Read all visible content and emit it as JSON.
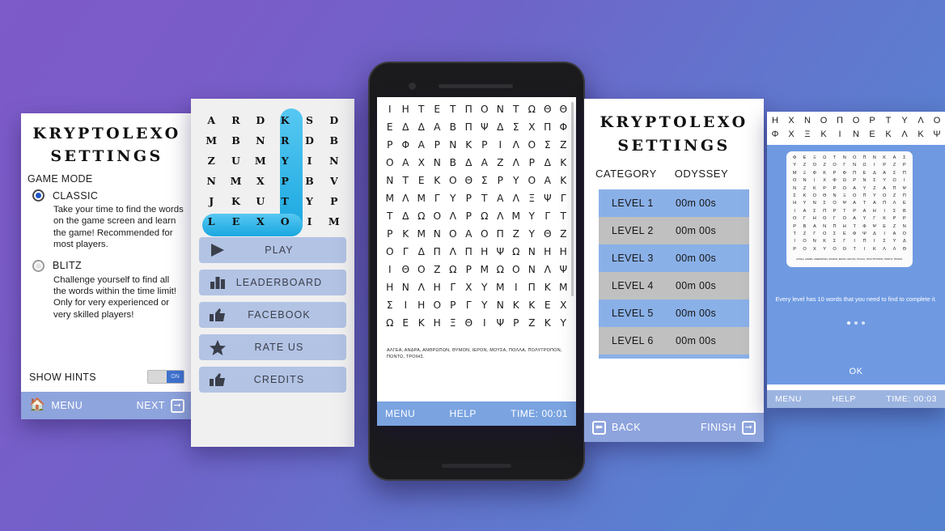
{
  "background": {
    "color_left": "#7a5cc8",
    "color_right": "#5583d0"
  },
  "settings_screen": {
    "title_line1": "KRYPTOLEXO",
    "title_line2": "SETTINGS",
    "section_label": "GAME MODE",
    "options": [
      {
        "name": "CLASSIC",
        "selected": true,
        "description": "Take your time to find the words on the game screen and learn the game! Recommended for most players."
      },
      {
        "name": "BLITZ",
        "selected": false,
        "description": "Challenge yourself to find all the words within the time limit! Only for very experienced or very skilled players!"
      }
    ],
    "hints_label": "SHOW HINTS",
    "hints_toggle_state": "ON",
    "bottom_bar": {
      "left_label": "MENU",
      "right_label": "NEXT"
    }
  },
  "mainmenu_screen": {
    "grid": [
      [
        "A",
        "R",
        "D",
        "K",
        "S",
        "D"
      ],
      [
        "M",
        "B",
        "N",
        "R",
        "D",
        "B"
      ],
      [
        "Z",
        "U",
        "M",
        "Y",
        "I",
        "N"
      ],
      [
        "N",
        "M",
        "X",
        "P",
        "B",
        "V"
      ],
      [
        "J",
        "K",
        "U",
        "T",
        "Y",
        "P"
      ],
      [
        "L",
        "E",
        "X",
        "O",
        "I",
        "M"
      ]
    ],
    "highlight_word_vertical": "KRYPTO",
    "highlight_word_horizontal": "LEXO",
    "buttons": [
      {
        "label": "PLAY",
        "icon": "play-icon"
      },
      {
        "label": "LEADERBOARD",
        "icon": "bars-icon"
      },
      {
        "label": "FACEBOOK",
        "icon": "thumbs-up-icon"
      },
      {
        "label": "RATE US",
        "icon": "star-icon"
      },
      {
        "label": "CREDITS",
        "icon": "thumbs-up-icon"
      }
    ]
  },
  "game_screen": {
    "grid": [
      [
        "Ι",
        "Η",
        "Τ",
        "Ε",
        "Τ",
        "Π",
        "Ο",
        "Ν",
        "Τ",
        "Ω",
        "Θ",
        "Θ"
      ],
      [
        "Ε",
        "Δ",
        "Δ",
        "Α",
        "Β",
        "Π",
        "Ψ",
        "Δ",
        "Σ",
        "Χ",
        "Π",
        "Φ"
      ],
      [
        "Ρ",
        "Φ",
        "Α",
        "Ρ",
        "Ν",
        "Κ",
        "Ρ",
        "Ι",
        "Λ",
        "Ο",
        "Σ",
        "Ζ"
      ],
      [
        "Ο",
        "Α",
        "Χ",
        "Ν",
        "Β",
        "Δ",
        "Α",
        "Ζ",
        "Λ",
        "Ρ",
        "Δ",
        "Κ"
      ],
      [
        "Ν",
        "Τ",
        "Ε",
        "Κ",
        "Ο",
        "Θ",
        "Σ",
        "Ρ",
        "Υ",
        "Ο",
        "Α",
        "Κ"
      ],
      [
        "Μ",
        "Λ",
        "Μ",
        "Γ",
        "Υ",
        "Ρ",
        "Τ",
        "Α",
        "Λ",
        "Ξ",
        "Ψ",
        "Γ"
      ],
      [
        "Τ",
        "Δ",
        "Ω",
        "Ο",
        "Λ",
        "Ρ",
        "Ω",
        "Λ",
        "Μ",
        "Υ",
        "Γ",
        "Τ"
      ],
      [
        "Ρ",
        "Κ",
        "Μ",
        "Ν",
        "Ο",
        "Α",
        "Ο",
        "Π",
        "Ζ",
        "Υ",
        "Θ",
        "Ζ"
      ],
      [
        "Ο",
        "Γ",
        "Δ",
        "Π",
        "Λ",
        "Π",
        "Η",
        "Ψ",
        "Ω",
        "Ν",
        "Η",
        "Η"
      ],
      [
        "Ι",
        "Θ",
        "Ο",
        "Ζ",
        "Ω",
        "Ρ",
        "Μ",
        "Ω",
        "Ο",
        "Ν",
        "Λ",
        "Ψ"
      ],
      [
        "Η",
        "Ν",
        "Λ",
        "Η",
        "Γ",
        "Χ",
        "Υ",
        "Μ",
        "Ι",
        "Π",
        "Κ",
        "Μ"
      ],
      [
        "Σ",
        "Ι",
        "Η",
        "Ο",
        "Ρ",
        "Γ",
        "Υ",
        "Ν",
        "Κ",
        "Κ",
        "Ε",
        "Χ"
      ],
      [
        "Ω",
        "Ε",
        "Κ",
        "Η",
        "Ξ",
        "Θ",
        "Ι",
        "Ψ",
        "Ρ",
        "Ζ",
        "Κ",
        "Υ"
      ]
    ],
    "word_list": "ΑΛΓΕΑ, ΑΝΔΡΑ, ΑΝΘΡΩΠΩΝ, ΘΥΜΟΝ, ΙΕΡΟΝ, ΜΟΥΣΑ, ΠΟΛΛΑ, ΠΟΛΥΤΡΟΠΟΝ, ΠΟΝΤΩ, ΤΡΟΙΗΣ.",
    "bottom_bar": {
      "menu": "MENU",
      "help": "HELP",
      "time": "TIME: 00:01"
    }
  },
  "levels_screen": {
    "title_line1": "KRYPTOLEXO",
    "title_line2": "SETTINGS",
    "category_label": "CATEGORY",
    "category_value": "ODYSSEY",
    "levels": [
      {
        "name": "LEVEL 1",
        "time": "00m 00s"
      },
      {
        "name": "LEVEL 2",
        "time": "00m 00s"
      },
      {
        "name": "LEVEL 3",
        "time": "00m 00s"
      },
      {
        "name": "LEVEL 4",
        "time": "00m 00s"
      },
      {
        "name": "LEVEL 5",
        "time": "00m 00s"
      },
      {
        "name": "LEVEL 6",
        "time": "00m 00s"
      }
    ],
    "bottom_bar": {
      "left_label": "BACK",
      "right_label": "FINISH"
    }
  },
  "help_screen": {
    "top_rows": [
      [
        "Η",
        "Χ",
        "Ν",
        "Ο",
        "Π",
        "Ο",
        "Ρ",
        "Τ",
        "Υ",
        "Λ",
        "Ο"
      ],
      [
        "Φ",
        "Χ",
        "Ξ",
        "Κ",
        "Ι",
        "Ν",
        "Ε",
        "Κ",
        "Λ",
        "Κ",
        "Ψ"
      ]
    ],
    "card_grid": [
      [
        "Φ",
        "Ε",
        "Ξ",
        "Ω",
        "Τ",
        "Ν",
        "Ο",
        "Π",
        "Ν",
        "Κ",
        "Α",
        "Σ"
      ],
      [
        "Υ",
        "Ζ",
        "Ο",
        "Ζ",
        "Ο",
        "Γ",
        "Ν",
        "Ω",
        "Ι",
        "Ρ",
        "Ζ",
        "Ρ"
      ],
      [
        "Μ",
        "Ξ",
        "Φ",
        "Κ",
        "Ρ",
        "Φ",
        "Π",
        "Ε",
        "Δ",
        "Α",
        "Σ",
        "Π"
      ],
      [
        "Ο",
        "Ν",
        "Ι",
        "Χ",
        "Φ",
        "Ω",
        "Ρ",
        "Ν",
        "Σ",
        "Υ",
        "Ο",
        "Ι"
      ],
      [
        "Ν",
        "Ζ",
        "Κ",
        "Ρ",
        "Ρ",
        "Ο",
        "Α",
        "Υ",
        "Ζ",
        "Α",
        "Π",
        "Ψ"
      ],
      [
        "Σ",
        "Κ",
        "Ο",
        "Θ",
        "Ν",
        "Ξ",
        "Ο",
        "Π",
        "Υ",
        "Ο",
        "Ζ",
        "Π"
      ],
      [
        "Η",
        "Υ",
        "Ν",
        "Σ",
        "Ο",
        "Ψ",
        "Α",
        "Τ",
        "Α",
        "Π",
        "Λ",
        "Ε"
      ],
      [
        "Ι",
        "Α",
        "Σ",
        "Π",
        "Ρ",
        "Τ",
        "Ρ",
        "Α",
        "Η",
        "Ι",
        "Σ",
        "Β"
      ],
      [
        "Ο",
        "Γ",
        "Η",
        "Ο",
        "Γ",
        "Ο",
        "Α",
        "Υ",
        "Γ",
        "Κ",
        "Ρ",
        "Ρ"
      ],
      [
        "Ρ",
        "Β",
        "Α",
        "Ν",
        "Π",
        "Η",
        "Τ",
        "Φ",
        "Ψ",
        "Ε",
        "Ζ",
        "Ν"
      ],
      [
        "Τ",
        "Ζ",
        "Γ",
        "Ο",
        "Σ",
        "Ε",
        "Φ",
        "Ψ",
        "Δ",
        "Ι",
        "Α",
        "Ο"
      ],
      [
        "Ι",
        "Ο",
        "Ν",
        "Κ",
        "Σ",
        "Γ",
        "Ι",
        "Π",
        "Ι",
        "Σ",
        "Υ",
        "Δ"
      ],
      [
        "Ρ",
        "Ο",
        "Χ",
        "Υ",
        "Ο",
        "Ο",
        "Τ",
        "Ι",
        "Κ",
        "Λ",
        "Λ",
        "Θ"
      ]
    ],
    "card_words": "ΑΛΓΕΑ, ΑΝΔΡΑ, ΑΝΘΡΩΠΩΝ, ΘΥΜΟΝ, ΙΕΡΟΝ, ΜΟΥΣΑ, ΠΟΛΛΑ, ΠΟΛΥΤΡΟΠΟΝ, ΠΟΝΤΩ, ΤΡΟΙΗΣ.",
    "message": "Every level has 10 words that you need to find to complete it.",
    "page_dots": 3,
    "active_dot": 0,
    "ok_label": "OK",
    "bottom_bar": {
      "menu": "MENU",
      "help": "HELP",
      "time": "TIME: 00:03"
    }
  }
}
